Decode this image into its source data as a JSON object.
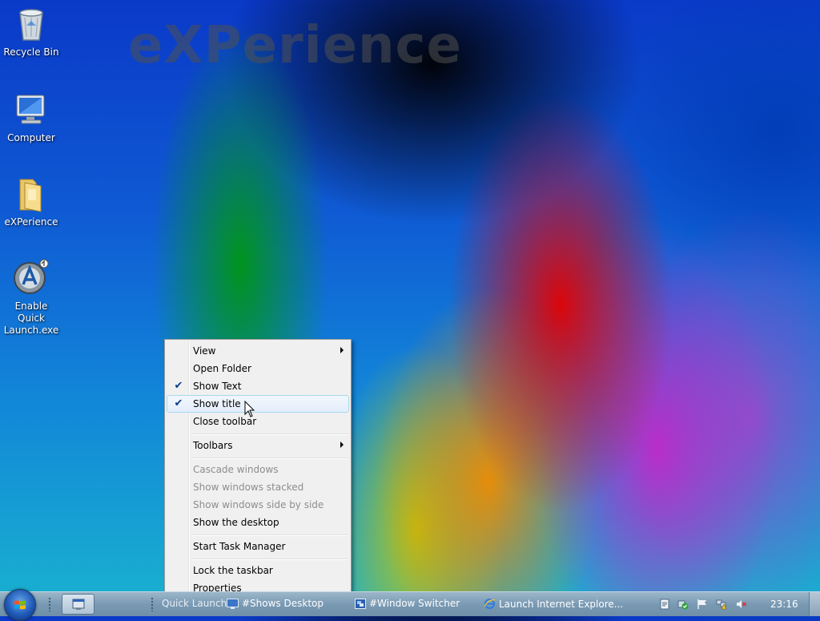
{
  "wallpaper": {
    "watermark_text": "eXPerience"
  },
  "desktop_icons": [
    {
      "label": "Recycle Bin"
    },
    {
      "label": "Computer"
    },
    {
      "label": "eXPerience"
    },
    {
      "label": "Enable Quick Launch.exe"
    }
  ],
  "context_menu": {
    "items": [
      {
        "label": "View",
        "submenu": true
      },
      {
        "label": "Open Folder"
      },
      {
        "label": "Show Text",
        "checked": true
      },
      {
        "label": "Show title",
        "checked": true,
        "highlighted": true
      },
      {
        "label": "Close toolbar"
      },
      {
        "label": "Toolbars",
        "submenu": true
      },
      {
        "label": "Cascade windows",
        "disabled": true
      },
      {
        "label": "Show windows stacked",
        "disabled": true
      },
      {
        "label": "Show windows side by side",
        "disabled": true
      },
      {
        "label": "Show the desktop"
      },
      {
        "label": "Start Task Manager"
      },
      {
        "label": "Lock the taskbar"
      },
      {
        "label": "Properties"
      }
    ]
  },
  "taskbar": {
    "quick_launch_label": "Quick Launch",
    "quick_launch_items": [
      {
        "label": "#Shows Desktop",
        "icon": "desktop-icon"
      },
      {
        "label": "#Window Switcher",
        "icon": "window-switcher-icon"
      },
      {
        "label": "Launch Internet Explore...",
        "icon": "internet-explorer-icon"
      }
    ],
    "clock": "23:16"
  },
  "colors": {
    "menu_bg": "#f0f0f0",
    "highlight_border": "#a8d8eb",
    "taskbar": "#7a9ab4"
  }
}
